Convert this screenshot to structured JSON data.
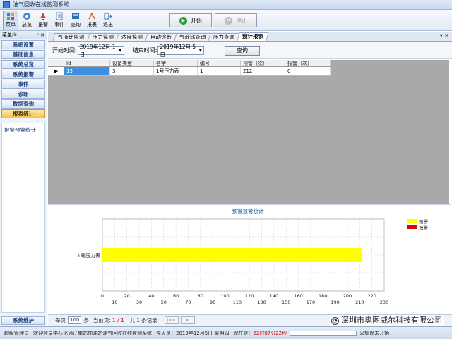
{
  "window": {
    "title": "油气回收在线监测系统"
  },
  "toolbar": {
    "buttons": [
      {
        "label": "菜单",
        "icon": "menu-icon"
      },
      {
        "label": "总览",
        "icon": "overview-icon"
      },
      {
        "label": "报警",
        "icon": "alarm-icon"
      },
      {
        "label": "事件",
        "icon": "event-icon"
      },
      {
        "label": "查询",
        "icon": "query-icon"
      },
      {
        "label": "报表",
        "icon": "report-icon"
      },
      {
        "label": "退出",
        "icon": "exit-icon"
      }
    ],
    "start_label": "开始",
    "stop_label": "停止"
  },
  "sidebar": {
    "header_label": "菜单栏",
    "header_controls": "ᵖ ✕",
    "items": [
      {
        "label": "系统设置"
      },
      {
        "label": "基础信息"
      },
      {
        "label": "系统总览"
      },
      {
        "label": "系统报警"
      },
      {
        "label": "事件"
      },
      {
        "label": "诊断"
      },
      {
        "label": "数据查询"
      },
      {
        "label": "报表统计"
      }
    ],
    "panel_item": "报警预警统计",
    "bottom_label": "系统维护"
  },
  "tabs": [
    {
      "label": "气液比监测"
    },
    {
      "label": "压力监测"
    },
    {
      "label": "浓度监测"
    },
    {
      "label": "自动诊断"
    },
    {
      "label": "气液比查询"
    },
    {
      "label": "压力查询"
    },
    {
      "label": "预计报表"
    }
  ],
  "tab_controls": "▾ ✕",
  "filter": {
    "start_label": "开始时间:",
    "start_value": "2019年12月 1日",
    "end_label": "结束时间:",
    "end_value": "2019年12月 5日",
    "query_label": "查询"
  },
  "grid": {
    "columns": [
      "Id",
      "设备类型",
      "名字",
      "编号",
      "预警（次）",
      "报警（次）"
    ],
    "rows": [
      {
        "indicator": "▶",
        "cells": [
          "13",
          "3",
          "1号压力表",
          "1",
          "212",
          "0"
        ]
      }
    ]
  },
  "chart_data": {
    "type": "bar",
    "orientation": "horizontal",
    "title": "预警报警统计",
    "categories": [
      "1号压力表"
    ],
    "series": [
      {
        "name": "预警",
        "values": [
          212
        ],
        "color": "#ffff00"
      },
      {
        "name": "报警",
        "values": [
          0
        ],
        "color": "#e00000"
      }
    ],
    "xlim": [
      0,
      230
    ],
    "x_ticks": [
      0,
      10,
      20,
      30,
      40,
      50,
      60,
      70,
      80,
      90,
      100,
      110,
      120,
      130,
      140,
      150,
      160,
      170,
      180,
      190,
      200,
      210,
      220,
      230
    ],
    "grid": true,
    "legend_position": "top-right"
  },
  "pager": {
    "per_page_label": "每页",
    "per_page_value": "100",
    "per_page_unit": "条",
    "current_label": "当前页:",
    "current_value": "1 / 1",
    "total_label": "共",
    "total_value": "1",
    "total_unit": "条记录",
    "first_btn": "|<<",
    "prev_btn": "<"
  },
  "watermark": {
    "text": "深圳市奥图威尔科技有限公司"
  },
  "status": {
    "user": "超级管理员",
    "welcome": "欢迎登录中石化通辽南站加油站油气回收在线监测系统",
    "today_label": "今天是：",
    "today_value": "2019年12月5日 星期四",
    "now_label": "现在是：",
    "now_value": "22时07分22秒",
    "state": "采集尚未开始"
  },
  "colors": {
    "accent": "#3d8fe3",
    "warning": "#ffff00",
    "alarm": "#e00000",
    "sidebar_active": "#f8c24c"
  }
}
